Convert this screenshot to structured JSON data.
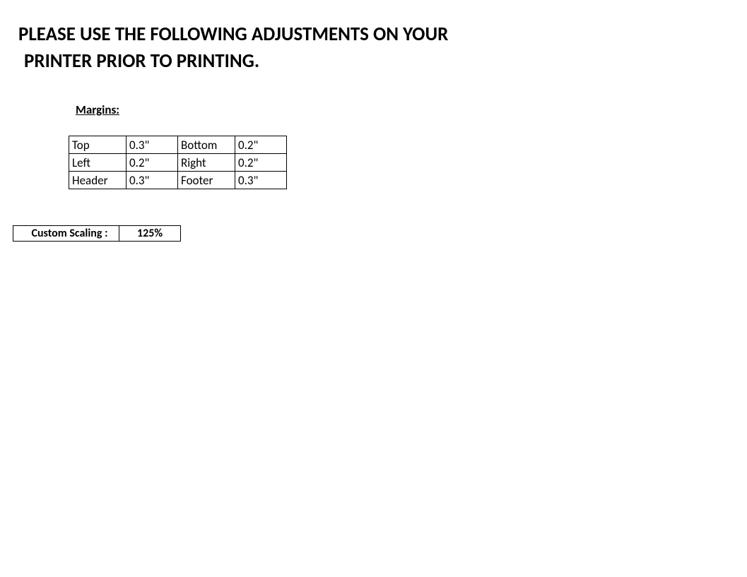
{
  "title_line1": "PLEASE USE THE FOLLOWING ADJUSTMENTS ON YOUR",
  "title_line2": "PRINTER PRIOR TO PRINTING.",
  "margins_label": "Margins:",
  "margins": {
    "rows": [
      {
        "label1": "Top",
        "value1": "0.3\"",
        "label2": "Bottom",
        "value2": "0.2\""
      },
      {
        "label1": "Left",
        "value1": "0.2\"",
        "label2": "Right",
        "value2": "0.2\""
      },
      {
        "label1": "Header",
        "value1": "0.3\"",
        "label2": "Footer",
        "value2": "0.3\""
      }
    ]
  },
  "scaling": {
    "label": "Custom Scaling :",
    "value": "125%"
  }
}
